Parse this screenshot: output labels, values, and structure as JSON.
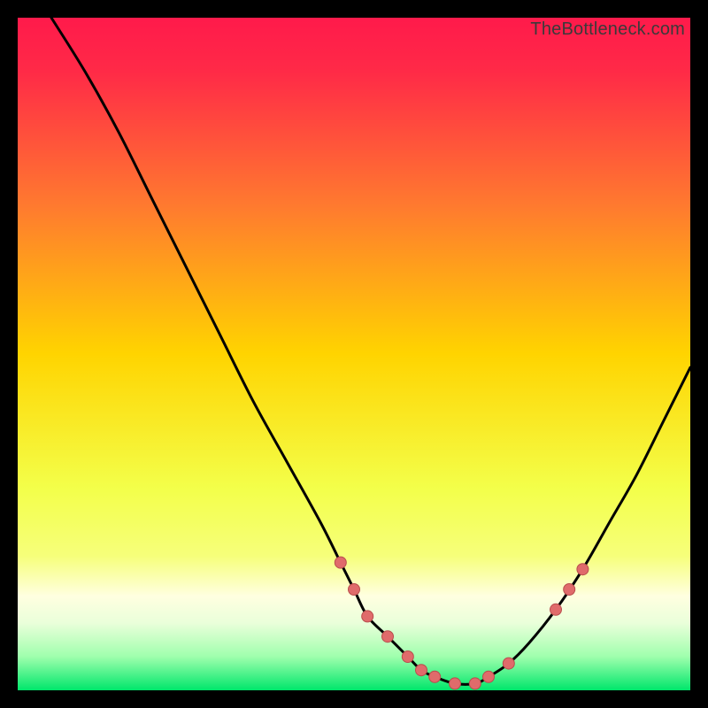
{
  "watermark": "TheBottleneck.com",
  "colors": {
    "gradient_top": "#ff1a4b",
    "gradient_mid": "#ffd400",
    "gradient_low": "#f6ff7a",
    "gradient_band_pale": "#eaffda",
    "gradient_bottom": "#00e66b",
    "curve": "#000000",
    "dot_fill": "#e06b6b",
    "dot_stroke": "#b94d4d",
    "background": "#000000",
    "watermark": "#3a3a3a"
  },
  "chart_data": {
    "type": "line",
    "title": "",
    "xlabel": "",
    "ylabel": "",
    "xlim": [
      0,
      100
    ],
    "ylim": [
      0,
      100
    ],
    "series": [
      {
        "name": "bottleneck-curve",
        "x": [
          5,
          10,
          15,
          20,
          25,
          30,
          35,
          40,
          45,
          48,
          50,
          52,
          55,
          58,
          60,
          62,
          65,
          68,
          70,
          73,
          76,
          80,
          84,
          88,
          92,
          96,
          100
        ],
        "y": [
          100,
          92,
          83,
          73,
          63,
          53,
          43,
          34,
          25,
          19,
          15,
          11,
          8,
          5,
          3,
          2,
          1,
          1,
          2,
          4,
          7,
          12,
          18,
          25,
          32,
          40,
          48
        ]
      }
    ],
    "dots": {
      "name": "highlight-points",
      "x": [
        48,
        50,
        52,
        55,
        58,
        60,
        62,
        65,
        68,
        70,
        73,
        80,
        82,
        84
      ],
      "y": [
        19,
        15,
        11,
        8,
        5,
        3,
        2,
        1,
        1,
        2,
        4,
        12,
        15,
        18
      ]
    }
  }
}
